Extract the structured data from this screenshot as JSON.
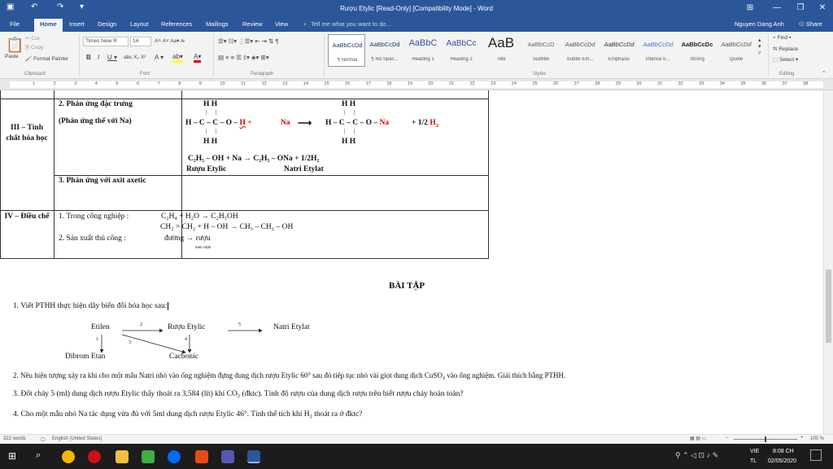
{
  "window": {
    "title": "Rượu Etylic [Read-Only] [Compatibility Mode] - Word",
    "user": "Nguyen Dang Anh",
    "share": "Share"
  },
  "tabs": [
    "File",
    "Home",
    "Insert",
    "Design",
    "Layout",
    "References",
    "Mailings",
    "Review",
    "View"
  ],
  "tell_me": "Tell me what you want to do...",
  "ribbon": {
    "clipboard": {
      "paste": "Paste",
      "cut": "Cut",
      "copy": "Copy",
      "format_painter": "Format Painter",
      "label": "Clipboard"
    },
    "font": {
      "name": "Times New R",
      "size": "14",
      "label": "Font"
    },
    "paragraph": {
      "label": "Paragraph"
    },
    "styles": {
      "label": "Styles",
      "items": [
        {
          "sample": "AaBbCcDd",
          "name": "¶ Normal"
        },
        {
          "sample": "AaBbCcDd",
          "name": "¶ No Spac..."
        },
        {
          "sample": "AaBbC",
          "name": "Heading 1"
        },
        {
          "sample": "AaBbCc",
          "name": "Heading 2"
        },
        {
          "sample": "AaB",
          "name": "Title"
        },
        {
          "sample": "AaBbCcD",
          "name": "Subtitle"
        },
        {
          "sample": "AaBbCcDd",
          "name": "Subtle Em..."
        },
        {
          "sample": "AaBbCcDd",
          "name": "Emphasis"
        },
        {
          "sample": "AaBbCcDd",
          "name": "Intense E..."
        },
        {
          "sample": "AaBbCcDc",
          "name": "Strong"
        },
        {
          "sample": "AaBbCcDd",
          "name": "Quote"
        }
      ]
    },
    "editing": {
      "find": "Find",
      "replace": "Replace",
      "select": "Select",
      "label": "Editing"
    }
  },
  "ruler": {
    "numbers": [
      "1",
      "2",
      "3",
      "4",
      "5",
      "6",
      "7",
      "8",
      "9",
      "10",
      "11",
      "12",
      "13",
      "14",
      "15",
      "16",
      "17",
      "18",
      "19",
      "20",
      "21",
      "22",
      "23",
      "24",
      "25",
      "26",
      "27",
      "28",
      "29",
      "30",
      "31",
      "32",
      "33",
      "34",
      "35",
      "36",
      "37",
      "38"
    ]
  },
  "table": {
    "row3": {
      "header": "III – Tính chất hóa học",
      "r1_title": "2. Phản ứng đặc trưng",
      "r1_sub": "(Phản ứng thế với Na)",
      "eq_left": "H – C – C – O –",
      "eq_h": "H",
      "eq_plus": "+",
      "eq_na": "Na",
      "arrow": "⟶",
      "eq_right": "H – C – C – O –",
      "eq_na2": "Na",
      "eq_half": "+ 1/2",
      "eq_h2": "H",
      "hh": "H    H",
      "formula": "C₂H₅ – OH  +  Na    →   C₂H₅ – ONa  +  1/2H₂",
      "name_left": "Rượu Etylic",
      "name_right": "Natri Etylat",
      "r2_title": "3. Phản ứng với axit axetic"
    },
    "row4": {
      "header": "IV – Điều chế",
      "l1": "1. Trong công nghiệp :",
      "l1_eq": "C₂H₄   +   H₂O   →   C₂H₅OH",
      "l1_eq2": "CH₂ = CH₂   +  H – OH   →   CH₃ – CH₂ – OH",
      "l2": "2. Sản xuất thủ công   :",
      "l2_eq": "đường   →   rượu",
      "l2_small": "men rượu"
    }
  },
  "exercise": {
    "title": "BÀI TẬP",
    "q1": "1. Viết PTHH thực hiện dãy biến đổi hóa học sau:",
    "nodes": {
      "etilen": "Etilen",
      "ruou": "Rượu Etylic",
      "natri": "Natri Etylat",
      "dibrom": "Dibrom Etan",
      "cacbonic": "Cacbonic"
    },
    "steps": [
      "1",
      "2",
      "3",
      "4",
      "5"
    ],
    "q2": "2. Nêu hiện tượng xảy ra khi cho một mẩu Natri nhỏ vào ống nghiệm đựng dung dịch rượu Etylic 60° sau đó tiếp tục nhỏ  vài giọt dung dịch CuSO₄ vào ống nghiệm. Giải thích bằng PTHH.",
    "q3": "3. Đốt cháy 5 (ml) dung dịch rượu Etylic thấy thoát ra 3,584 (lít) khí CO₂ (đktc). Tính độ rượu của dung dịch rượu trên biết rượu cháy hoàn toàn?",
    "q4": "4. Cho một mẫu nhỏ Na tác dụng vừa đủ với 5ml dung dịch rượu Etylic 46°. Tính thể tích khí H₂ thoát ra ở đktc?"
  },
  "status": {
    "words": "322 words",
    "language": "English (United States)",
    "zoom": "100 %"
  },
  "taskbar": {
    "lang1": "VIE",
    "lang2": "TL",
    "time": "8:08 CH",
    "date": "02/05/2020"
  }
}
